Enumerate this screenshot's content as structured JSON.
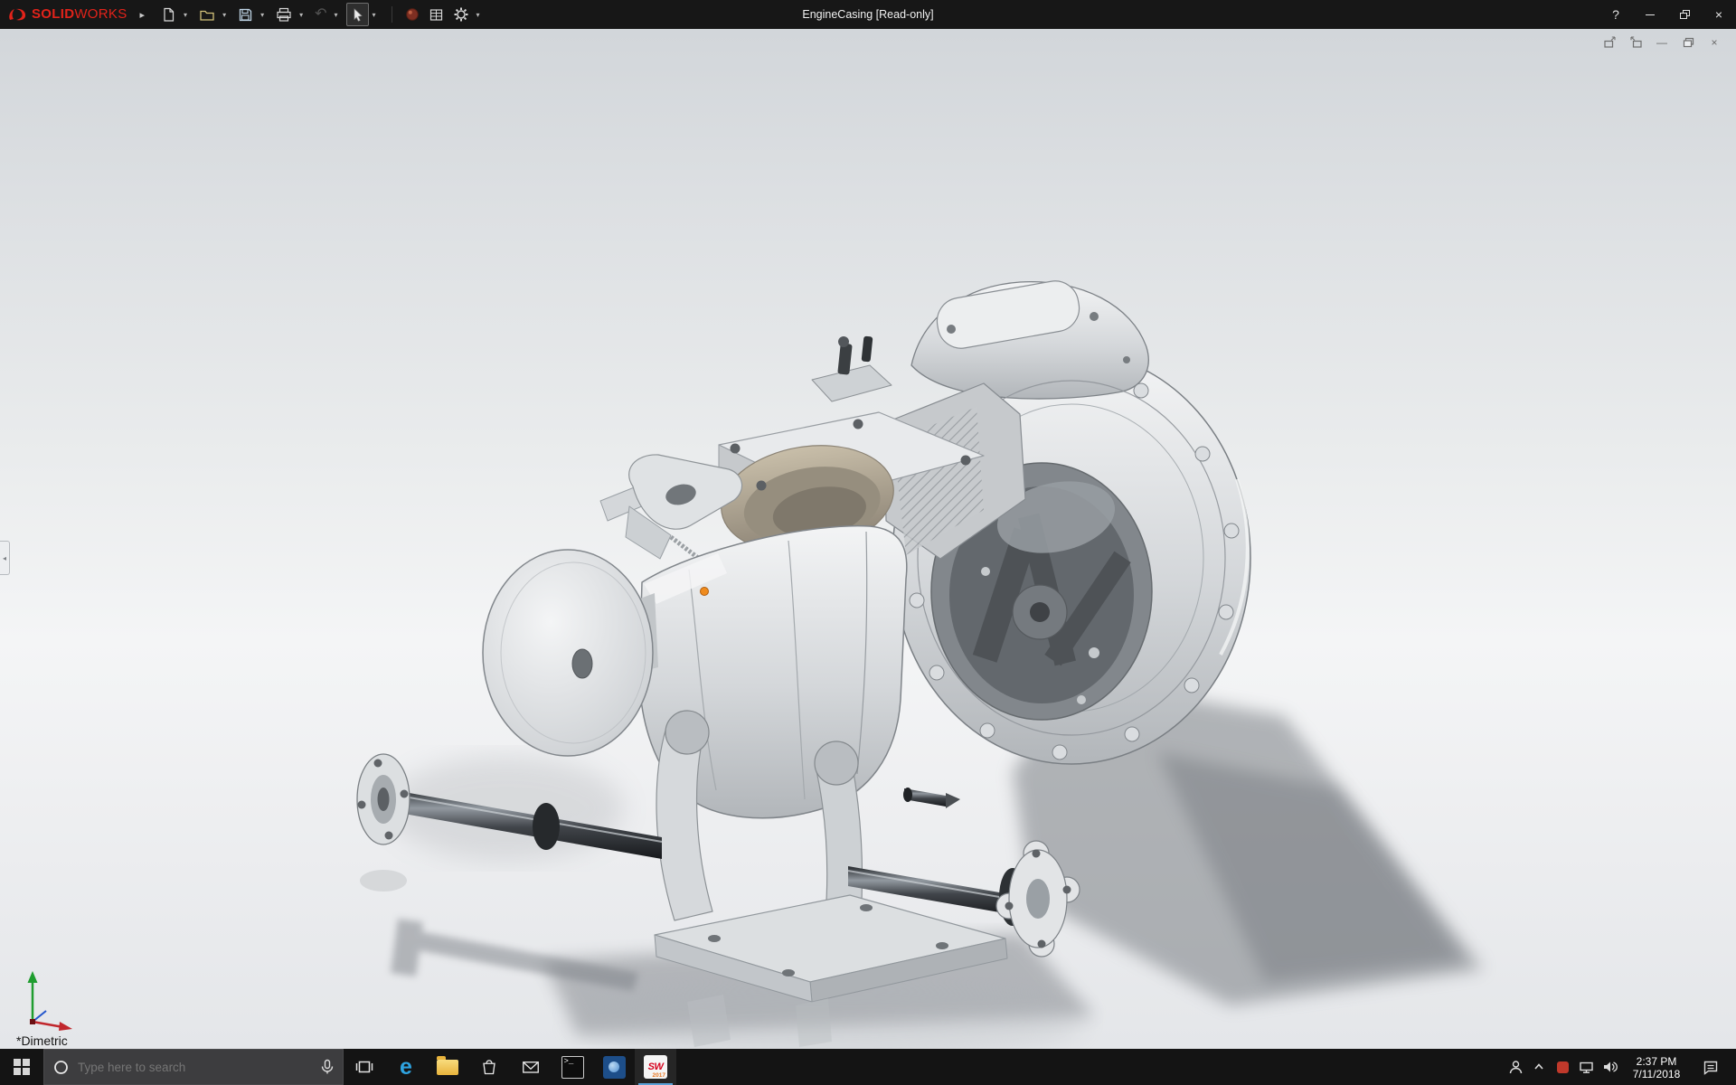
{
  "titlebar": {
    "brand": {
      "solid": "SOLID",
      "works": "WORKS"
    },
    "flyout_arrow": "▸",
    "dropdown_caret": "▾",
    "undo_glyph": "↶",
    "title": "EngineCasing [Read-only]",
    "help": "?",
    "minimize": "—",
    "close": "×"
  },
  "toolbar_icons": [
    "new-document",
    "open",
    "save",
    "print",
    "undo",
    "select",
    "appearance",
    "evaluate",
    "options"
  ],
  "doc_controls": {
    "minimize": "—",
    "close": "×"
  },
  "viewport": {
    "orientation_label": "*Dimetric",
    "selection_marker_color": "#ef8b1d"
  },
  "taskbar": {
    "search": {
      "placeholder": "Type here to search"
    },
    "edge_glyph": "e",
    "cmd_glyph": ">_",
    "solidworks_icon": {
      "text": "SW",
      "year": "2017"
    },
    "clock": {
      "time": "2:37 PM",
      "date": "7/11/2018"
    },
    "tray_icons": [
      "people",
      "chevron-up",
      "gpu",
      "network",
      "volume",
      "action-center"
    ]
  },
  "colors": {
    "brand_red": "#e2231a",
    "titlebar_bg": "#171717",
    "taskbar_bg": "#141414",
    "active_app_underline": "#5aa2d8",
    "selection_orange": "#ef8b1d"
  }
}
